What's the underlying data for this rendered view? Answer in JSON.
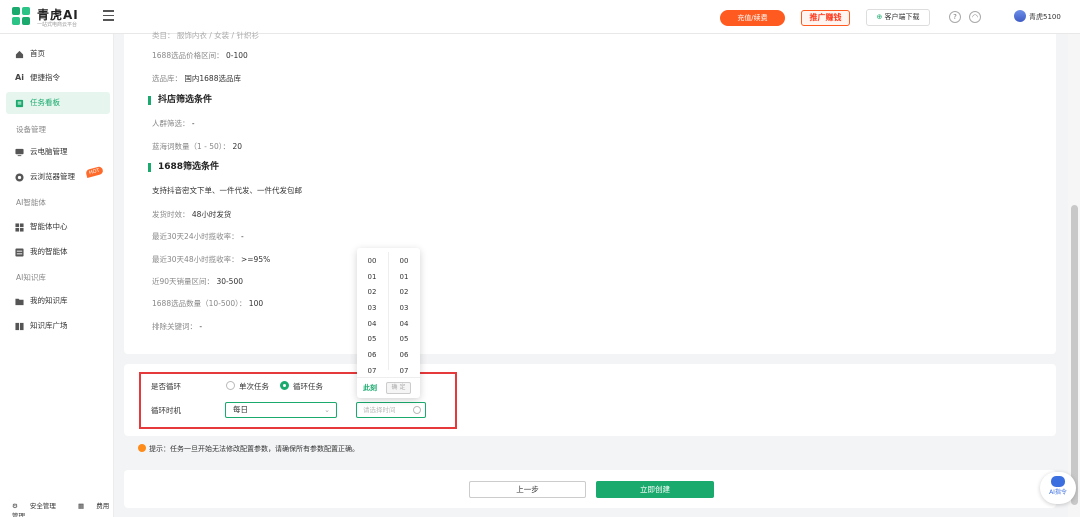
{
  "header": {
    "brand": "青虎AI",
    "brand_sub": "一站式电商云平台",
    "recharge_label": "充值/续费",
    "promo_label": "推广赚钱",
    "download_label": "客户端下载",
    "user_name": "青虎5100"
  },
  "sidebar": {
    "items": [
      {
        "label": "首页"
      },
      {
        "label": "便捷指令"
      },
      {
        "label": "任务看板"
      },
      {
        "label": "云电脑管理"
      },
      {
        "label": "云浏览器管理"
      },
      {
        "label": "智能体中心"
      },
      {
        "label": "我的智能体"
      },
      {
        "label": "我的知识库"
      },
      {
        "label": "知识库广场"
      }
    ],
    "sections": [
      "设备管理",
      "AI智能体",
      "AI知识库"
    ],
    "footer": [
      "安全管理",
      "费用管理"
    ]
  },
  "details": {
    "partial_top": "类目：    服饰内衣 / 女装 / 针织衫",
    "price_range_label": "1688选品价格区间：",
    "price_range_value": "0-100",
    "library_label": "选品库：",
    "library_value": "国内1688选品库",
    "douyin_title": "抖店筛选条件",
    "crowd_label": "人群筛选：",
    "crowd_value": "-",
    "blue_ocean_label": "蓝海词数量（1 - 50）：",
    "blue_ocean_value": "20",
    "ali_title": "1688筛选条件",
    "support_text": "支持抖音密文下单、一件代发、一件代发包邮",
    "ship_label": "发货时效：",
    "ship_value": "48小时发货",
    "rate24_label": "最近30天24小时揽收率：",
    "rate24_value": "-",
    "rate48_label": "最近30天48小时揽收率：",
    "rate48_value": ">=95%",
    "sales_label": "近90天销量区间：",
    "sales_value": "30-500",
    "count_label": "1688选品数量（10-500）：",
    "count_value": "100",
    "exclude_label": "排除关键词：",
    "exclude_value": "-"
  },
  "cycle": {
    "loop_label": "是否循环",
    "opt_single": "单次任务",
    "opt_loop": "循环任务",
    "timing_label": "循环时机",
    "select_value": "每日",
    "time_placeholder": "请选择时间"
  },
  "time_picker": {
    "hours": [
      "00",
      "01",
      "02",
      "03",
      "04",
      "05",
      "06",
      "07"
    ],
    "minutes": [
      "00",
      "01",
      "02",
      "03",
      "04",
      "05",
      "06",
      "07"
    ],
    "now_label": "此刻",
    "ok_label": "确 定"
  },
  "tip": "提示：任务一旦开始无法修改配置参数，请确保所有参数配置正确。",
  "actions": {
    "prev_label": "上一步",
    "create_label": "立即创建"
  },
  "ai_fab_label": "AI指令",
  "colors": {
    "accent": "#1aaa6e",
    "recharge": "#ff5a1f",
    "highlight_box": "#e5393b"
  }
}
